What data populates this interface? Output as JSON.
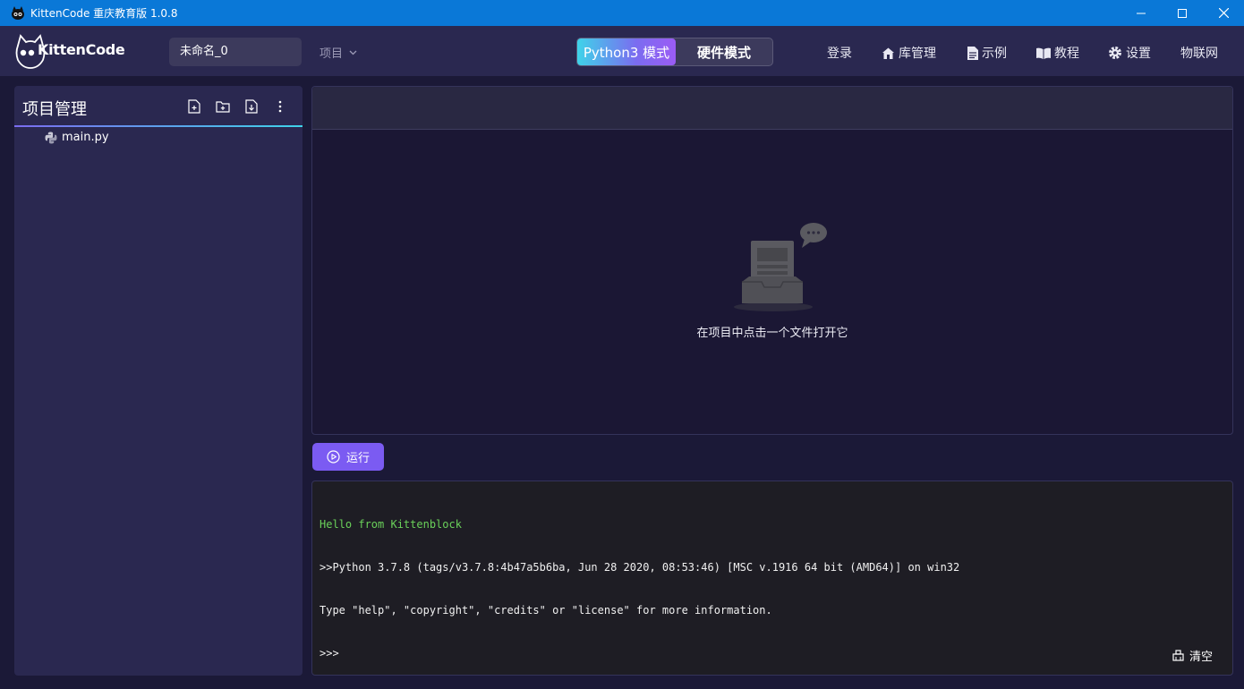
{
  "window": {
    "title": "KittenCode 重庆教育版 1.0.8"
  },
  "header": {
    "logo_text": "KittenCode",
    "project_name": "未命名_0",
    "project_menu": "项目",
    "mode_python": "Python3 模式",
    "mode_hardware": "硬件模式",
    "nav": {
      "login": "登录",
      "library": "库管理",
      "examples": "示例",
      "tutorial": "教程",
      "settings": "设置",
      "iot": "物联网"
    }
  },
  "project_panel": {
    "title": "项目管理",
    "files": [
      {
        "name": "main.py"
      }
    ]
  },
  "editor": {
    "empty_message": "在项目中点击一个文件打开它"
  },
  "run_button": "运行",
  "console": {
    "lines": [
      "Hello from Kittenblock",
      ">>Python 3.7.8 (tags/v3.7.8:4b47a5b6ba, Jun 28 2020, 08:53:46) [MSC v.1916 64 bit (AMD64)] on win32",
      "Type \"help\", \"copyright\", \"credits\" or \"license\" for more information.",
      ">>>"
    ],
    "clear_label": "清空"
  },
  "colors": {
    "titlebar": "#0a78d7",
    "header": "#2a2850",
    "background": "#1b1937",
    "accent": "#7b5bf2",
    "console_green": "#6ad15a"
  }
}
